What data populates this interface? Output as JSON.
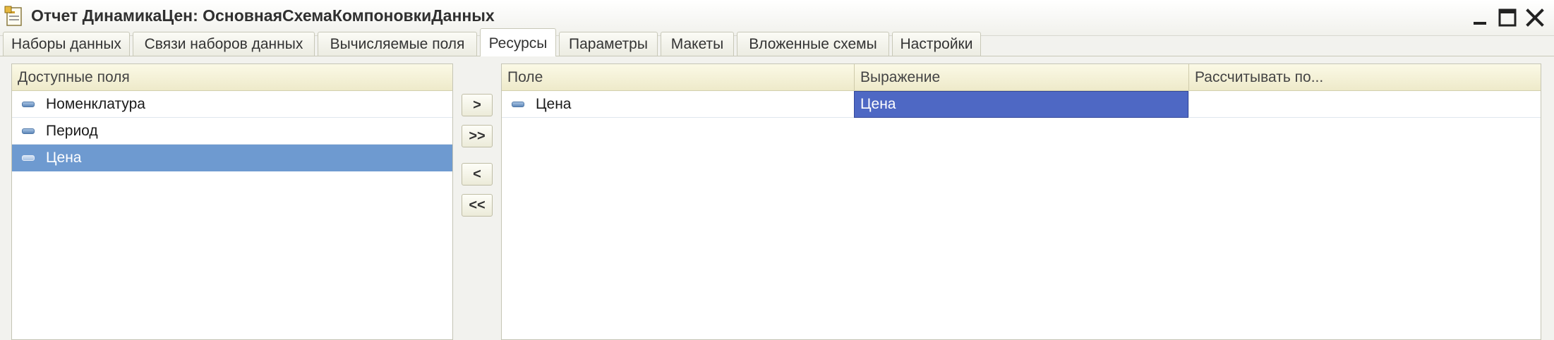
{
  "window": {
    "title": "Отчет ДинамикаЦен: ОсновнаяСхемаКомпоновкиДанных",
    "icon": "report-icon",
    "controls": [
      "minimize-icon",
      "maximize-icon",
      "close-icon"
    ]
  },
  "tabs": [
    {
      "label": "Наборы данных",
      "active": false
    },
    {
      "label": "Связи наборов данных",
      "active": false
    },
    {
      "label": "Вычисляемые поля",
      "active": false
    },
    {
      "label": "Ресурсы",
      "active": true
    },
    {
      "label": "Параметры",
      "active": false
    },
    {
      "label": "Макеты",
      "active": false
    },
    {
      "label": "Вложенные схемы",
      "active": false
    },
    {
      "label": "Настройки",
      "active": false
    }
  ],
  "available_fields": {
    "header": "Доступные поля",
    "items": [
      {
        "label": "Номенклатура",
        "selected": false,
        "icon": "field-icon"
      },
      {
        "label": "Период",
        "selected": false,
        "icon": "field-icon"
      },
      {
        "label": "Цена",
        "selected": true,
        "icon": "field-icon"
      }
    ]
  },
  "move_buttons": [
    ">",
    ">>",
    "<",
    "<<"
  ],
  "resources": {
    "columns": [
      "Поле",
      "Выражение",
      "Рассчитывать по..."
    ],
    "rows": [
      {
        "field": "Цена",
        "expression": "Цена",
        "calc_by": "",
        "icon": "field-icon"
      }
    ]
  },
  "colors": {
    "selection_row": "#6e9ad0",
    "selection_cell": "#4e68c4",
    "header_bg": "#eeeaca",
    "accent_icon": "#5e87b8"
  }
}
